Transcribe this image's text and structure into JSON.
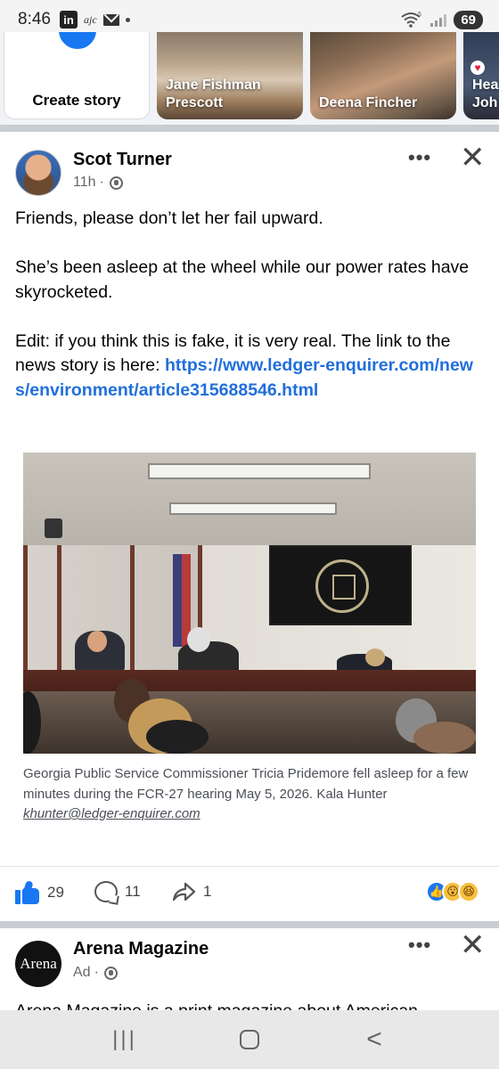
{
  "status_bar": {
    "time": "8:46",
    "linkedin_icon": "in",
    "ajc_icon": "ajc",
    "wifi_badge": "5",
    "battery": "69"
  },
  "stories": {
    "create_label": "Create story",
    "items": [
      {
        "name_line1": "Jane Fishman",
        "name_line2": "Prescott"
      },
      {
        "name_line1": "Deena Fincher",
        "name_line2": ""
      },
      {
        "name_line1": "Hea",
        "name_line2": "Joh"
      }
    ]
  },
  "post": {
    "author": "Scot Turner",
    "time": "11h",
    "separator": "·",
    "paragraphs": [
      "Friends, please don’t let her fail upward.",
      "She’s been asleep at the wheel while our power rates have skyrocketed."
    ],
    "edit_text": "Edit: if you think this is fake, it is very real.  The link to the news story is here:",
    "link": "https://www.ledger-enquirer.com/news/environment/article315688546.html",
    "caption": "Georgia Public Service Commissioner Tricia Pridemore fell asleep for a few minutes during the FCR-27 hearing May 5, 2026. Kala Hunter",
    "caption_email": "khunter@ledger-enquirer.com",
    "likes": "29",
    "comments": "11",
    "shares": "1"
  },
  "ad": {
    "name": "Arena Magazine",
    "avatar_text": "Arena",
    "label": "Ad",
    "separator": "·",
    "text": "Arena Magazine is a print magazine about American"
  },
  "nav": {
    "recent": "|||",
    "back": "<"
  },
  "colors": {
    "facebook_blue": "#1877f2",
    "link_blue": "#216fdb",
    "secondary_text": "#65676b"
  }
}
